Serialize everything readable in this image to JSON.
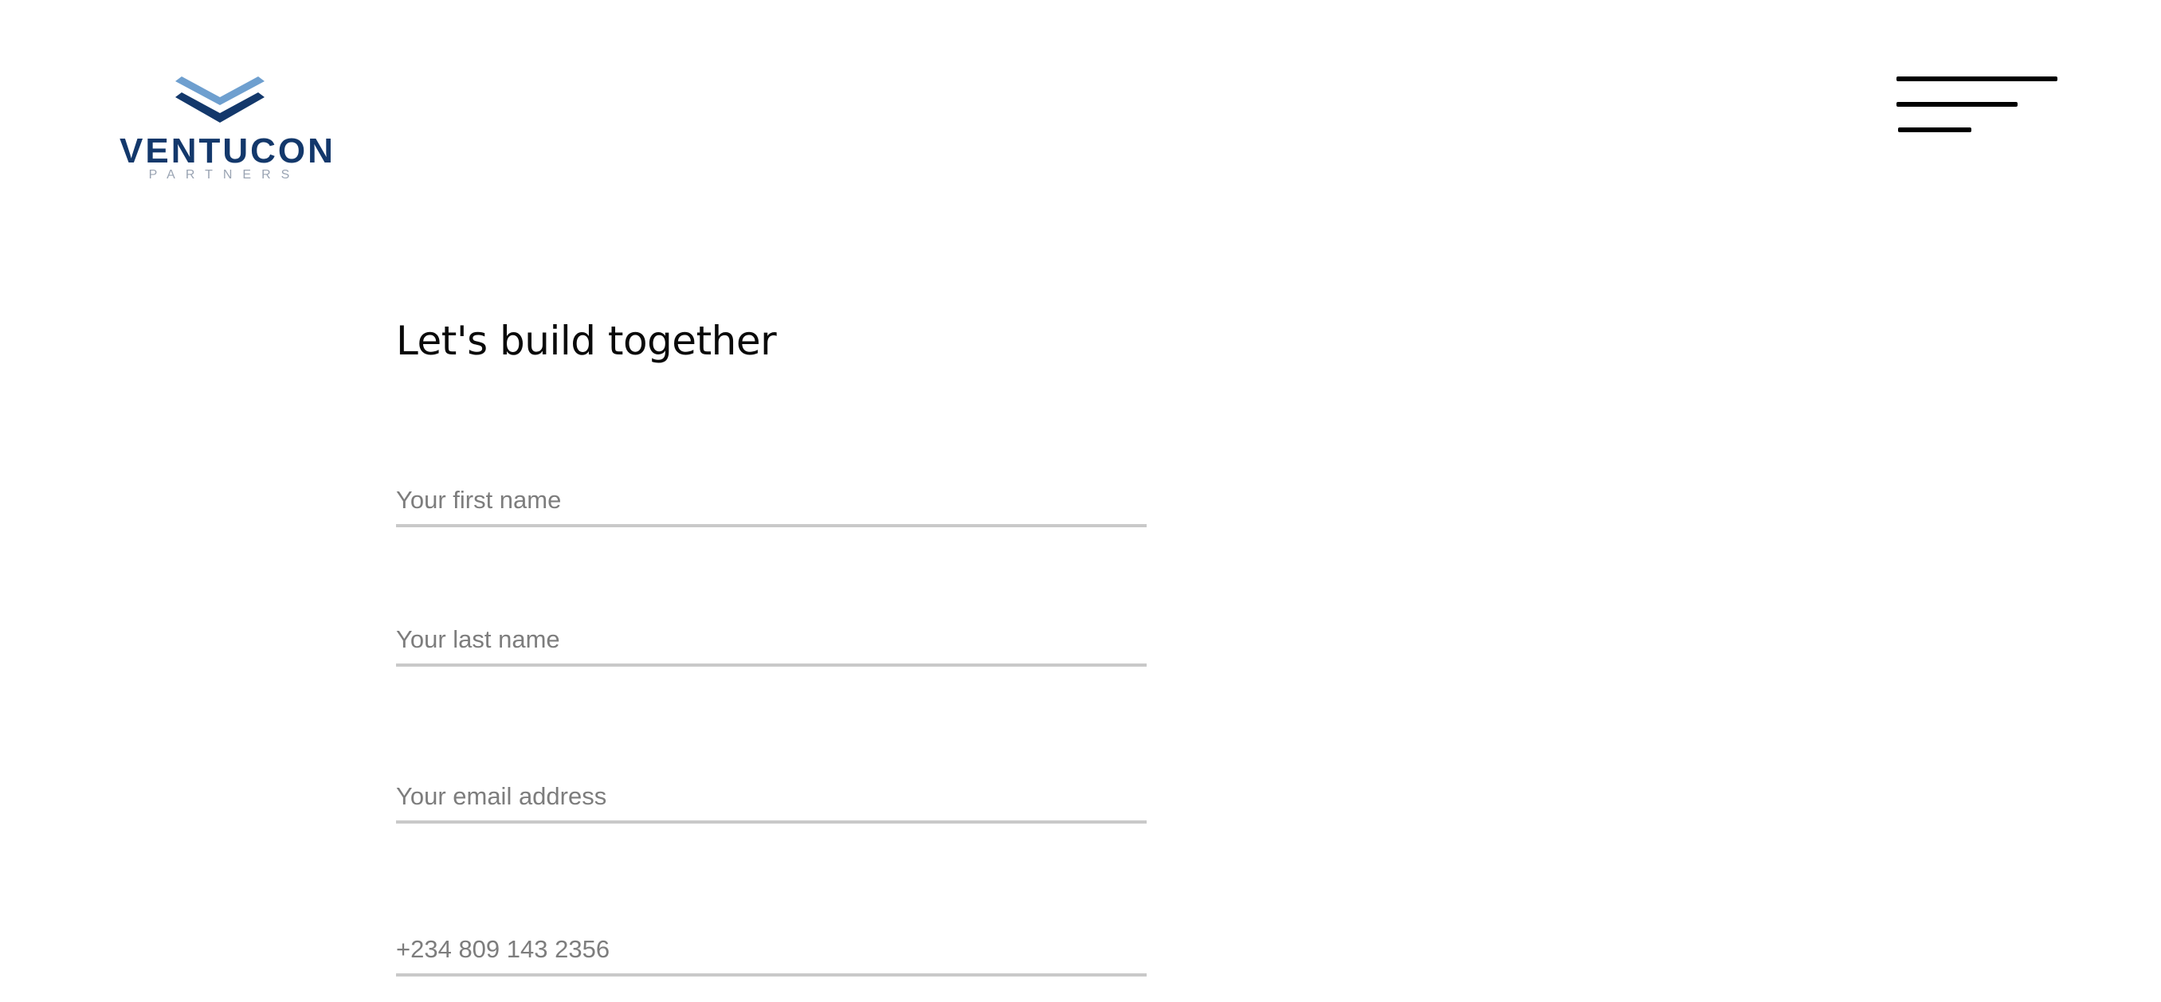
{
  "brand": {
    "name": "VENTUCON",
    "tagline": "PARTNERS",
    "colors": {
      "chevron_light": "#6e9fcf",
      "chevron_dark": "#13386b"
    }
  },
  "header": {
    "menu_icon": "hamburger-menu-icon"
  },
  "main": {
    "title": "Let's build together",
    "form": {
      "first_name_placeholder": "Your first name",
      "last_name_placeholder": "Your last name",
      "email_placeholder": "Your email address",
      "phone_placeholder": "+234 809 143 2356"
    }
  }
}
